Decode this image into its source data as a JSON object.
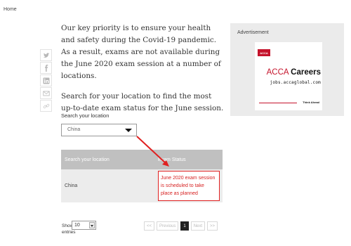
{
  "breadcrumb": {
    "home": "Home"
  },
  "share": {
    "icons": [
      "twitter-icon",
      "facebook-icon",
      "linkedin-icon",
      "email-icon",
      "link-icon"
    ]
  },
  "intro": {
    "paragraph1": "Our key priority is to ensure your health and safety during the Covid-19 pandemic. As a result, exams are not available during the June 2020 exam session at a number of locations.",
    "paragraph2": "Search for your location to find the most up-to-date exam status for the June session."
  },
  "search": {
    "label": "Search your location",
    "selected": "China"
  },
  "table": {
    "headers": [
      "Search your location",
      "Exam Status"
    ],
    "rows": [
      {
        "location": "China",
        "status": "June 2020 exam session is scheduled to take place as planned"
      }
    ]
  },
  "length_menu": {
    "show": "Show",
    "value": "10",
    "entries": "entries"
  },
  "pagination": {
    "first": "<<",
    "previous": "Previous",
    "current": "1",
    "next": "Next",
    "last": ">>"
  },
  "advert": {
    "label": "Advertisement",
    "badge": "ACCA",
    "title_prefix": "ACCA",
    "title_bold": "Careers",
    "url": "jobs.accaglobal.com",
    "tagline": "Think Ahead"
  },
  "colors": {
    "highlight_red": "#e02020",
    "acca_red": "#c5132b",
    "table_header": "#c0c0c0",
    "table_row": "#ececec",
    "ad_panel": "#ebebeb"
  }
}
